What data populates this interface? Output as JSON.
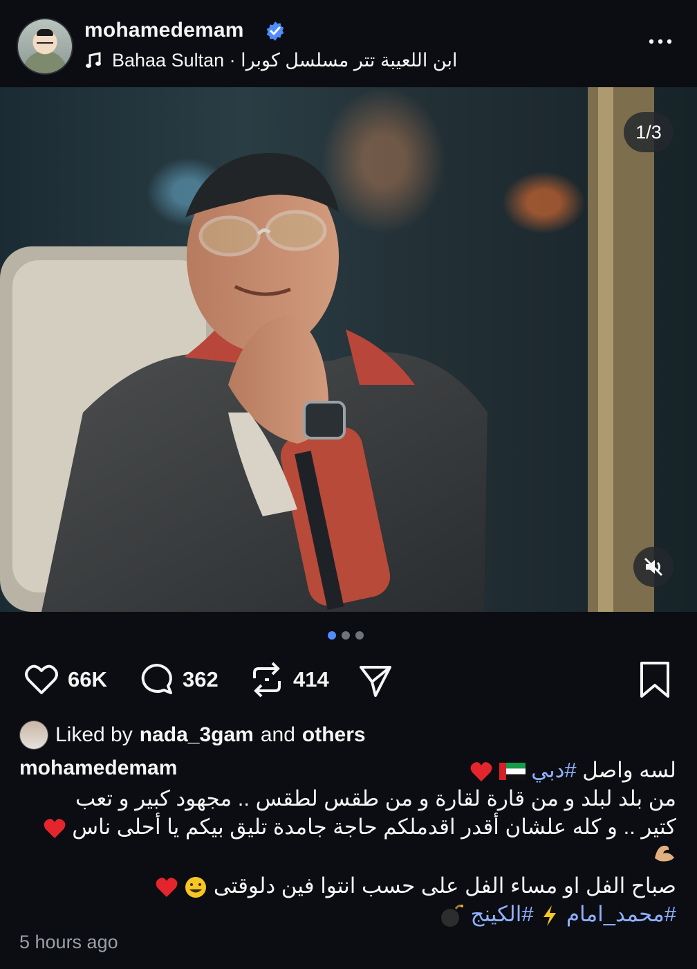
{
  "header": {
    "username": "mohamedemam",
    "music_text": "Bahaa Sultan · ابن اللعيبة تتر مسلسل كوبرا"
  },
  "media": {
    "counter": "1/3",
    "description": ""
  },
  "actions": {
    "likes": "66K",
    "comments": "362",
    "reposts": "414"
  },
  "liked": {
    "prefix": "Liked by ",
    "user": "nada_3gam",
    "middle": " and ",
    "others": "others"
  },
  "caption": {
    "username": "mohamedemam",
    "line1_text": "لسه واصل ",
    "line1_tag": "#دبي",
    "line2": "من بلد لبلد و من قارة لقارة و من طقس لطقس .. مجهود كبير و تعب",
    "line3": "كتير .. و كله علشان أقدر اقدملكم حاجة جامدة تليق بيكم يا أحلى ناس",
    "line5": "صباح الفل او مساء الفل على حسب انتوا فين دلوقتى",
    "tag1": "#محمد_امام",
    "tag2": "#الكينج"
  },
  "timestamp": "5 hours ago",
  "colors": {
    "background": "#0b0d12",
    "accent": "#4f8dff",
    "hashtag": "#8fb0ff"
  },
  "icons": [
    "music-note-icon",
    "verified-badge-icon",
    "more-icon",
    "mute-icon",
    "heart-icon",
    "comment-icon",
    "repost-icon",
    "share-icon",
    "bookmark-icon"
  ]
}
